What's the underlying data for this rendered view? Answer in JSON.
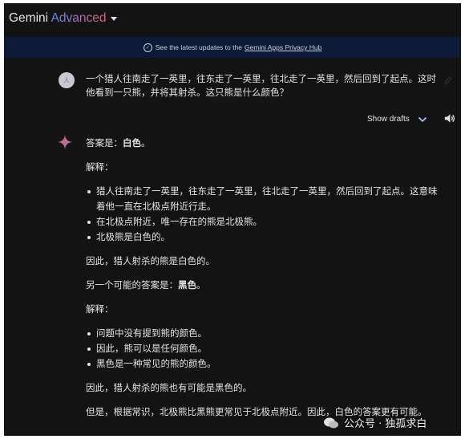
{
  "header": {
    "brand": "Gemini",
    "brand_suffix": "Advanced"
  },
  "banner": {
    "text": "See the latest updates to the",
    "link": "Gemini Apps Privacy Hub"
  },
  "prompt": {
    "avatar_text": "人",
    "text": "一个猎人往南走了一英里，往东走了一英里，往北走了一英里，然后回到了起点。这时他看到一只熊，并将其射杀。这只熊是什么颜色？"
  },
  "drafts": {
    "label": "Show drafts"
  },
  "answer": {
    "line1_prefix": "答案是：",
    "line1_bold": "白色",
    "line1_suffix": "。",
    "explain1": "解释：",
    "bullets1": [
      "猎人往南走了一英里，往东走了一英里，往北走了一英里，然后回到了起点。这意味着他一直在北极点附近行走。",
      "在北极点附近，唯一存在的熊是北极熊。",
      "北极熊是白色的。"
    ],
    "conclusion1": "因此，猎人射杀的熊是白色的。",
    "line2_prefix": "另一个可能的答案是：",
    "line2_bold": "黑色",
    "line2_suffix": "。",
    "explain2": "解释：",
    "bullets2": [
      "问题中没有提到熊的颜色。",
      "因此，熊可以是任何颜色。",
      "黑色是一种常见的熊的颜色。"
    ],
    "conclusion2": "因此，猎人射杀的熊也有可能是黑色的。",
    "last": "但是，根据常识，北极熊比黑熊更常见于北极点附近。因此，白色的答案更有可能。"
  },
  "watermark": {
    "text": "公众号 · 独孤求白"
  },
  "colors": {
    "background": "#131314",
    "banner": "#0c1a35",
    "text": "#e3e3e3",
    "accent": "#a8c7fa"
  }
}
